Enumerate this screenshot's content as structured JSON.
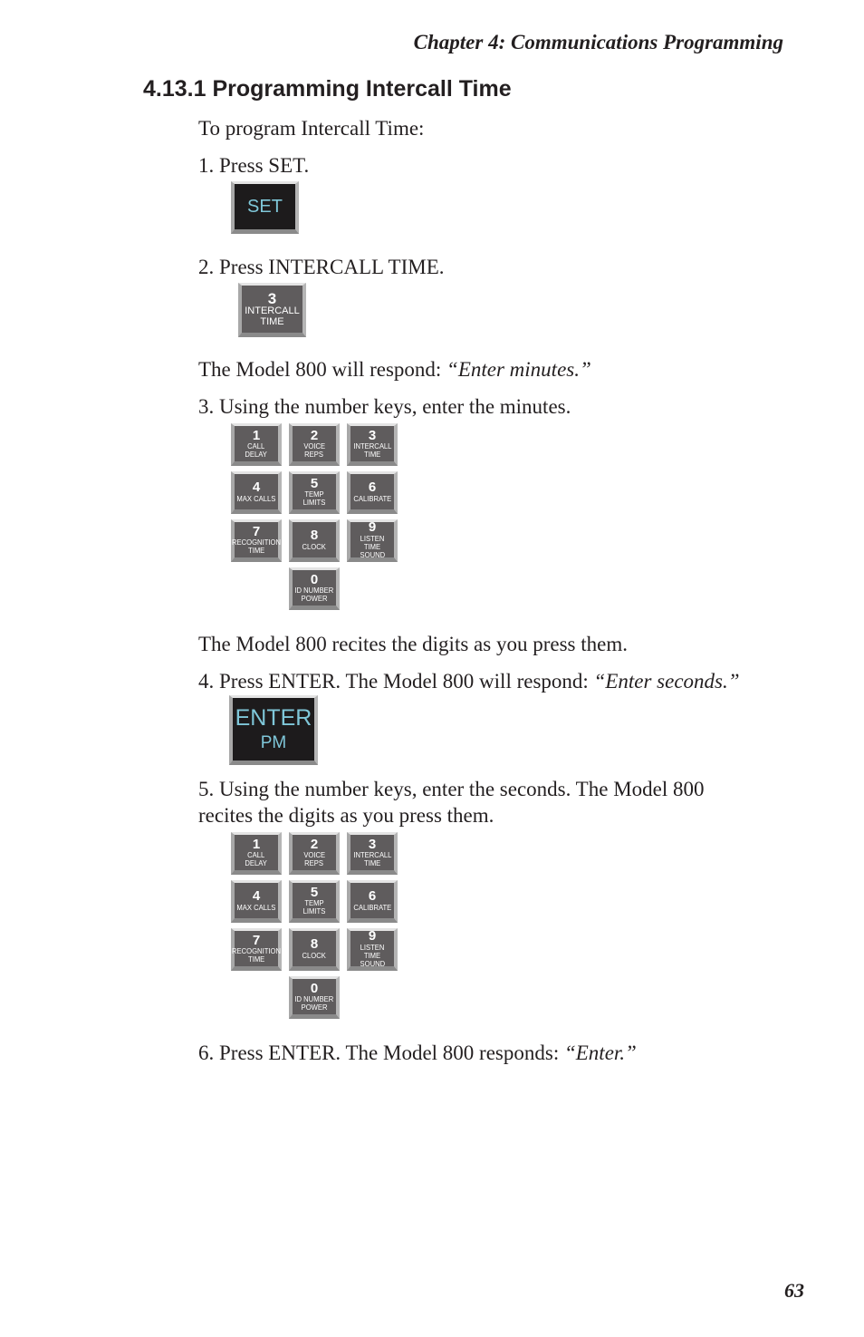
{
  "header": "Chapter 4:  Communications Programming",
  "section_title": "4.13.1  Programming Intercall Time",
  "intro": "To program Intercall Time:",
  "steps": {
    "s1": "1.  Press SET.",
    "s2": "2.  Press INTERCALL TIME.",
    "respond1_prefix": "The  Model 800 will respond: ",
    "respond1_quote": "“Enter minutes.”",
    "s3": "3.  Using the number keys, enter the minutes.",
    "recites": "The Model 800 recites the digits as you press them.",
    "s4_prefix": "4.  Press ENTER. The Model 800 will respond: ",
    "s4_quote": "“Enter seconds.”",
    "s5_line1": "5.  Using the number keys, enter the seconds. The Model 800",
    "s5_line2": "recites the digits as you press them.",
    "s6_prefix": "6.  Press ENTER. The Model 800 responds: ",
    "s6_quote": "“Enter.”"
  },
  "keys": {
    "set": "SET",
    "intercall": {
      "num": "3",
      "l1": "INTERCALL",
      "l2": "TIME"
    },
    "enter": {
      "l1": "ENTER",
      "l2": "PM"
    }
  },
  "keypad": [
    {
      "num": "1",
      "l1": "CALL",
      "l2": "DELAY"
    },
    {
      "num": "2",
      "l1": "VOICE",
      "l2": "REPS"
    },
    {
      "num": "3",
      "l1": "INTERCALL",
      "l2": "TIME"
    },
    {
      "num": "4",
      "l1": "MAX CALLS",
      "l2": ""
    },
    {
      "num": "5",
      "l1": "TEMP LIMITS",
      "l2": ""
    },
    {
      "num": "6",
      "l1": "CALIBRATE",
      "l2": ""
    },
    {
      "num": "7",
      "l1": "RECOGNITION",
      "l2": "TIME"
    },
    {
      "num": "8",
      "l1": "CLOCK",
      "l2": ""
    },
    {
      "num": "9",
      "l1": "LISTEN TIME",
      "l2": "SOUND"
    },
    {
      "num": "0",
      "l1": "ID NUMBER",
      "l2": "POWER"
    }
  ],
  "colors": {
    "dark_key": "#1d1b1c",
    "grey_key": "#5f5c5d",
    "key_text_cyan": "#7fc7d9"
  },
  "page_number": "63"
}
